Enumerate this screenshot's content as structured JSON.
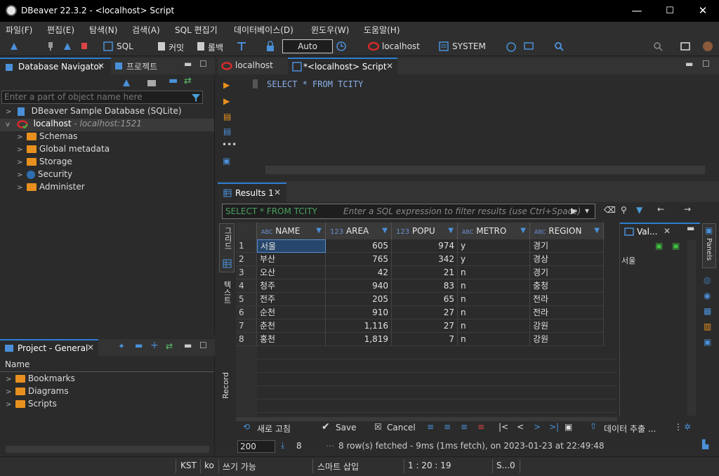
{
  "window": {
    "title": "DBeaver 22.3.2 - <localhost> Script",
    "minimize": "—",
    "maximize": "☐",
    "close": "✕"
  },
  "menu": [
    "파일(F)",
    "편집(E)",
    "탐색(N)",
    "검색(A)",
    "SQL 편집기",
    "데이터베이스(D)",
    "윈도우(W)",
    "도움말(H)"
  ],
  "toolbar": {
    "sql": "SQL",
    "commit": "커밋",
    "rollback": "롤백",
    "auto": "Auto",
    "connection": "localhost",
    "schema": "SYSTEM"
  },
  "navigator": {
    "tab_label": "Database Navigator",
    "tab2_label": "프로젝트",
    "filter_placeholder": "Enter a part of object name here",
    "items": [
      {
        "label": "DBeaver Sample Database (SQLite)"
      },
      {
        "label": "localhost",
        "sub": " - localhost:1521"
      },
      {
        "label": "Schemas"
      },
      {
        "label": "Global metadata"
      },
      {
        "label": "Storage"
      },
      {
        "label": "Security"
      },
      {
        "label": "Administer"
      }
    ]
  },
  "project": {
    "tab_label": "Project - General",
    "column": "Name",
    "items": [
      "Bookmarks",
      "Diagrams",
      "Scripts"
    ]
  },
  "editor": {
    "tabs": [
      "localhost",
      "*<localhost> Script"
    ],
    "sql": "SELECT * FROM TCITY"
  },
  "results": {
    "tab_label": "Results 1",
    "filter_query": "SELECT * FROM TCITY",
    "filter_placeholder": "Enter a SQL expression to filter results (use Ctrl+Space)",
    "side_tabs": {
      "grid": "그리드",
      "text": "텍스트",
      "record": "Record"
    },
    "columns": [
      {
        "label": "NAME",
        "type": "ABC"
      },
      {
        "label": "AREA",
        "type": "123"
      },
      {
        "label": "POPU",
        "type": "123"
      },
      {
        "label": "METRO",
        "type": "ABC"
      },
      {
        "label": "REGION",
        "type": "ABC"
      }
    ],
    "rows": [
      [
        "1",
        "서울",
        "605",
        "974",
        "y",
        "경기"
      ],
      [
        "2",
        "부산",
        "765",
        "342",
        "y",
        "경상"
      ],
      [
        "3",
        "오산",
        "42",
        "21",
        "n",
        "경기"
      ],
      [
        "4",
        "청주",
        "940",
        "83",
        "n",
        "충청"
      ],
      [
        "5",
        "전주",
        "205",
        "65",
        "n",
        "전라"
      ],
      [
        "6",
        "순천",
        "910",
        "27",
        "n",
        "전라"
      ],
      [
        "7",
        "춘천",
        "1,116",
        "27",
        "n",
        "강원"
      ],
      [
        "8",
        "홍천",
        "1,819",
        "7",
        "n",
        "강원"
      ]
    ],
    "value_panel": {
      "tab_label": "Val...",
      "value": "서울",
      "panels_label": "Panels"
    },
    "bottom": {
      "refresh": "새로 고침",
      "save": "Save",
      "cancel": "Cancel",
      "export": "데이터 추출 ..."
    },
    "fetch_size": "200",
    "row_count": "8",
    "status": "8 row(s) fetched - 9ms (1ms fetch), on 2023-01-23 at 22:49:48"
  },
  "statusbar": {
    "tz": "KST",
    "lang": "ko",
    "writable": "쓰기 가능",
    "insert": "스마트 삽입",
    "pos": "1 : 20 : 19",
    "sel": "S...0"
  },
  "colors": {
    "accent": "#2d7fd4",
    "selected_cell": "#27466b",
    "folder": "#e8901f",
    "oracle_red": "#d42a2a"
  }
}
